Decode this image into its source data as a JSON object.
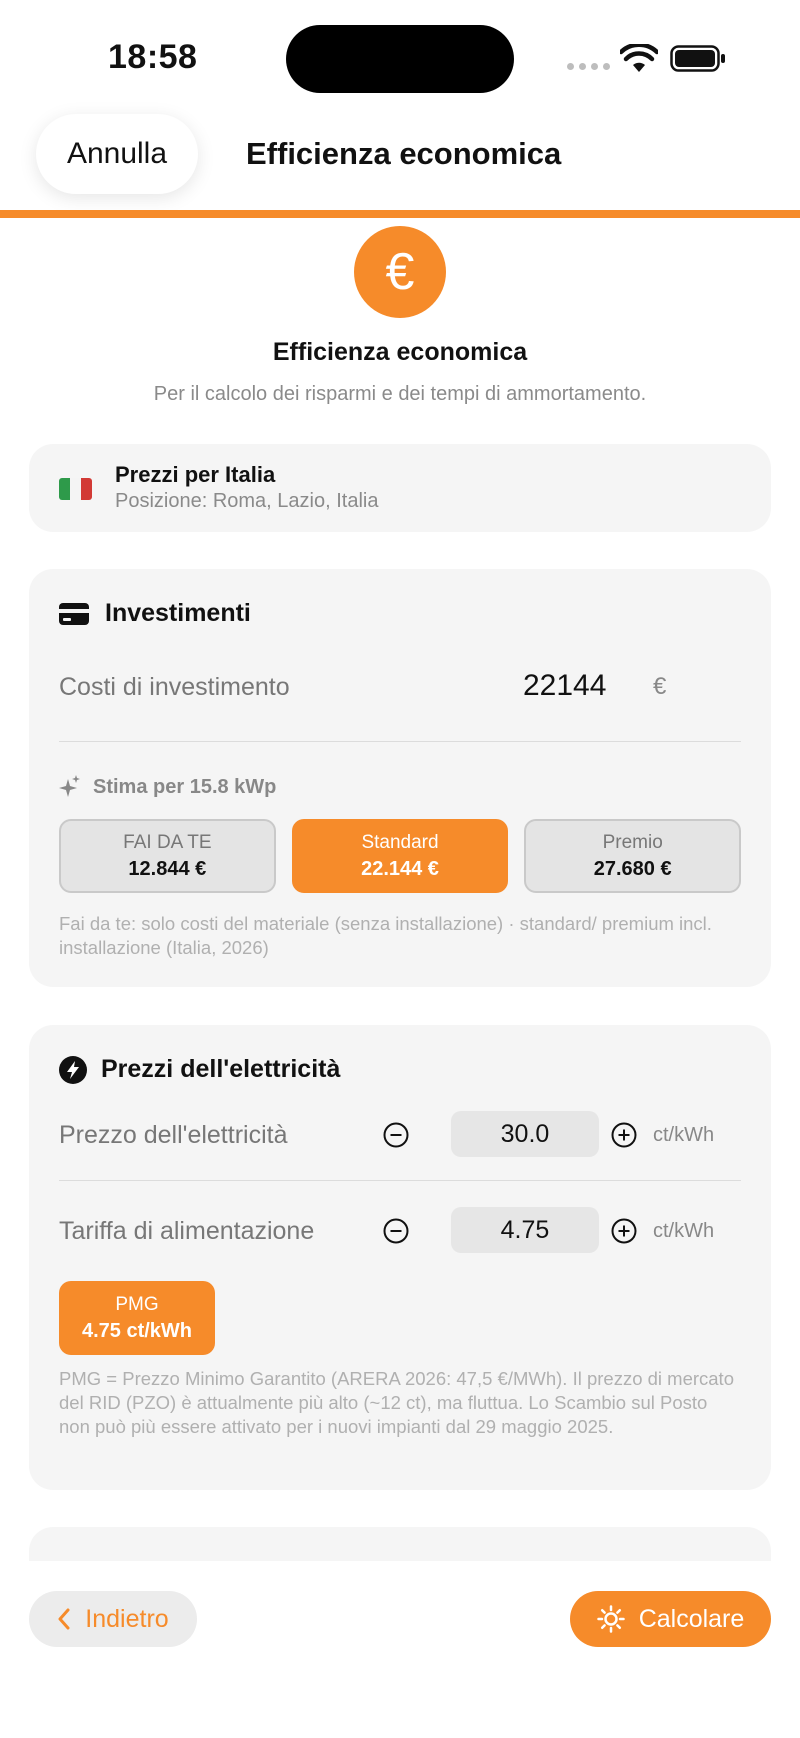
{
  "status": {
    "time": "18:58"
  },
  "nav": {
    "cancel_label": "Annulla",
    "title": "Efficienza economica",
    "progress": 1.0
  },
  "hero": {
    "icon": "euro-icon",
    "icon_glyph": "€",
    "title": "Efficienza economica",
    "subtitle": "Per il calcolo dei risparmi e dei tempi di ammortamento."
  },
  "location": {
    "flag": "italy-flag-icon",
    "title": "Prezzi per Italia",
    "subtitle": "Posizione: Roma, Lazio, Italia"
  },
  "investment": {
    "icon": "credit-card-icon",
    "title": "Investimenti",
    "cost_label": "Costi di investimento",
    "cost_value": "22144",
    "cost_unit": "€",
    "estimate_icon": "sparkle-icon",
    "estimate_label": "Stima per 15.8 kWp",
    "presets": [
      {
        "name": "FAI DA TE",
        "value": "12.844 €",
        "selected": false
      },
      {
        "name": "Standard",
        "value": "22.144 €",
        "selected": true
      },
      {
        "name": "Premio",
        "value": "27.680 €",
        "selected": false
      }
    ],
    "note": "Fai da te: solo costi del materiale (senza installazione) · standard/ premium incl. installazione (Italia, 2026)"
  },
  "electricity": {
    "icon": "bolt-icon",
    "title": "Prezzi dell'elettricità",
    "rows": [
      {
        "label": "Prezzo dell'elettricità",
        "value": "30.0",
        "unit": "ct/kWh"
      },
      {
        "label": "Tariffa di alimentazione",
        "value": "4.75",
        "unit": "ct/kWh"
      }
    ],
    "pmg_name": "PMG",
    "pmg_value": "4.75 ct/kWh",
    "note": "PMG = Prezzo Minimo Garantito (ARERA 2026: 47,5 €/MWh). Il prezzo di mercato del RID (PZO) è attualmente più alto (~12 ct), ma fluttua. Lo Scambio sul Posto non può più essere attivato per i nuovi impianti dal 29 maggio 2025."
  },
  "bottom": {
    "back_label": "Indietro",
    "calc_label": "Calcolare"
  },
  "colors": {
    "accent": "#f68b2a",
    "card_bg": "#f5f5f5",
    "muted_text": "#8a8a8a"
  }
}
